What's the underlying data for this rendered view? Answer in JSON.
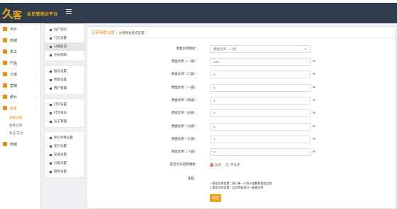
{
  "header": {
    "brand": "会员管理云平台"
  },
  "colors": {
    "topbar": "#2f3d4f",
    "accent": "#e58c12",
    "button": "#f2a01e",
    "radio_on": "#e5392b"
  },
  "sidebar": {
    "items": [
      {
        "label": "卡片",
        "icon": "home-icon",
        "color": "#e58c12"
      },
      {
        "label": "商城",
        "icon": "shop-icon",
        "color": "#e58c12"
      },
      {
        "label": "员工",
        "icon": "staff-icon",
        "color": "#e58c12"
      },
      {
        "label": "产品",
        "icon": "product-icon",
        "color": "#e58c12"
      },
      {
        "label": "订单",
        "icon": "order-icon",
        "color": "#e58c12"
      },
      {
        "label": "营销",
        "icon": "marketing-icon",
        "color": "#e58c12"
      },
      {
        "label": "统计",
        "icon": "stats-icon",
        "color": "#e58c12"
      },
      {
        "label": "设置",
        "icon": "settings-icon",
        "color": "#e58c12"
      }
    ],
    "sub_items": [
      "基础设置",
      "插件应用",
      "积分/支付"
    ],
    "last_item": {
      "label": "商城",
      "icon": "grid-icon"
    }
  },
  "subnav": {
    "groups": [
      [
        "商户资料",
        "门店设置",
        "分销提成",
        "会员等级"
      ],
      [
        "短信设置",
        "佣金设置",
        "用户管理"
      ],
      [
        "打印设置",
        "打印日志",
        "员工管理"
      ],
      [
        "积分兑换设置",
        "支付设置",
        "充值设置",
        "分类设置",
        "服务设置"
      ]
    ]
  },
  "page": {
    "breadcrumb_main": "佳商参数设置",
    "breadcrumb_current": "分销佣金提成设置"
  },
  "form": {
    "select_label": "佣金比率模式：",
    "select_value": "佣金比率（一级）",
    "rows": [
      {
        "label": "佣金比例（一级）：",
        "value": "100"
      },
      {
        "label": "佣金比例（二级）：",
        "value": "0"
      },
      {
        "label": "佣金比例（一级）：",
        "value": "0"
      },
      {
        "label": "佣金比例（高级）：",
        "value": "0"
      },
      {
        "label": "佣金比例（五级）：",
        "value": "0"
      },
      {
        "label": "佣金比例（六级）：",
        "value": "0"
      },
      {
        "label": "佣金比例（七级）：",
        "value": "0"
      },
      {
        "label": "佣金比例（八级）：",
        "value": "0"
      }
    ],
    "percent": "%",
    "radio_label": "是否允许自购佣金：",
    "radio_options": [
      "允许",
      "不允许"
    ],
    "radio_selected": 0,
    "notes_label": "注意：",
    "notes": [
      "1.佣金比例设置：按订单一卡合计金额和佣金比例",
      "2.佣金比例设置：会员等级划分一级佣金率"
    ],
    "save_label": "保存"
  }
}
